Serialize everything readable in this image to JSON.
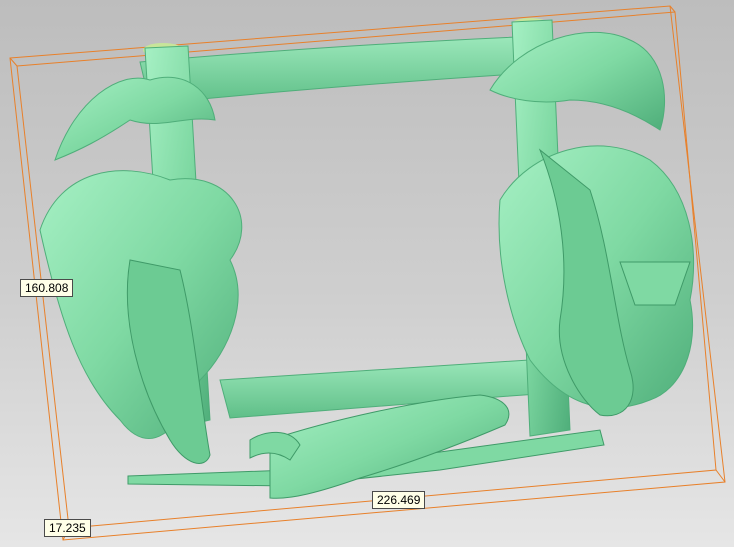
{
  "viewport": {
    "background_top": "#bdbdbd",
    "background_bottom": "#e6e6e6",
    "model_color": "#7fd9a3",
    "model_shadow": "#4fae7a",
    "bounding_box_color": "#e8802a"
  },
  "dimensions": {
    "height": "160.808",
    "width": "226.469",
    "depth": "17.235"
  },
  "model": {
    "icon": "carved-relief-frame-icon"
  }
}
